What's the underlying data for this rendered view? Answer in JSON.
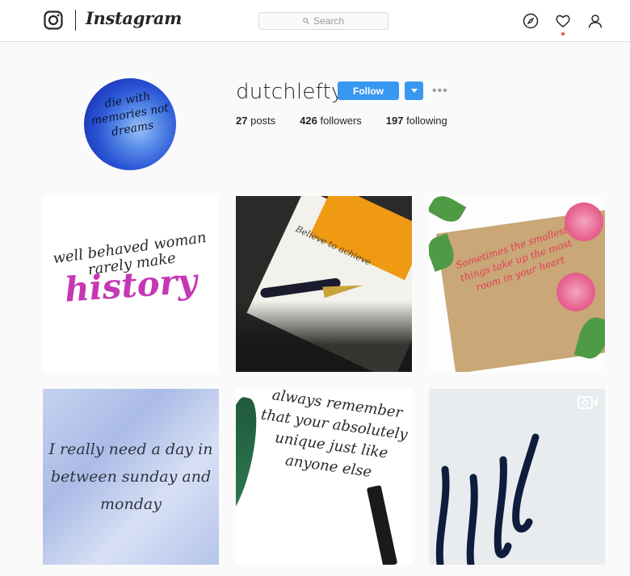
{
  "nav": {
    "wordmark": "Instagram",
    "search_placeholder": "Search"
  },
  "profile": {
    "username": "dutchlefty",
    "follow_label": "Follow",
    "more_label": "•••",
    "avatar_text": "die with memories not dreams",
    "stats": [
      {
        "count": "27",
        "label": "posts"
      },
      {
        "count": "426",
        "label": "followers"
      },
      {
        "count": "197",
        "label": "following"
      }
    ]
  },
  "posts": [
    {
      "line1": "well behaved woman rarely make",
      "line2": "history"
    },
    {
      "text": "Believe to achieve"
    },
    {
      "text": "Sometimes the smallest things take up the most room in your heart"
    },
    {
      "text": "I really need a day in between sunday and monday"
    },
    {
      "text": "always remember that your absolutely unique just like anyone else"
    },
    {
      "type": "video"
    }
  ],
  "colors": {
    "accent": "#3897f0",
    "notification_dot": "#ed4956"
  }
}
